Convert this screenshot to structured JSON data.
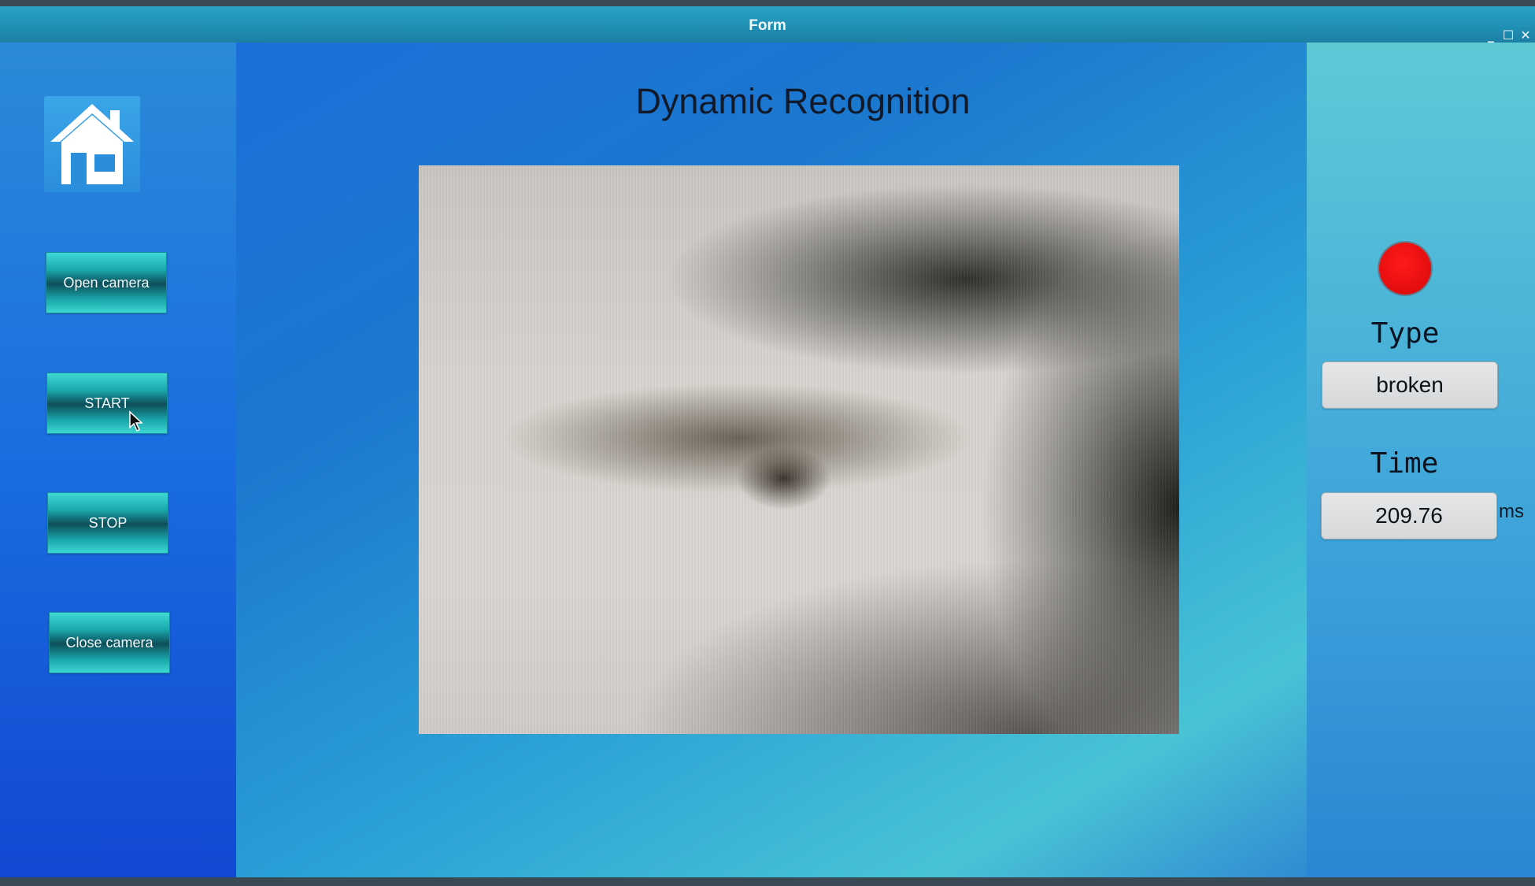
{
  "window": {
    "title": "Form",
    "controls": {
      "minimize": "_",
      "maximize": "☐",
      "close": "✕"
    }
  },
  "header": {
    "title": "Dynamic Recognition"
  },
  "sidebar": {
    "home_icon": "home-icon",
    "buttons": [
      {
        "label": "Open camera"
      },
      {
        "label": "START"
      },
      {
        "label": "STOP"
      },
      {
        "label": "Close camera"
      }
    ]
  },
  "results": {
    "status_color": "#e60f0f",
    "type_label": "Type",
    "type_value": "broken",
    "time_label": "Time",
    "time_value": "209.76",
    "time_unit": "ms"
  },
  "colors": {
    "titlebar": "#2aa3c6",
    "button_teal": "#19a9ad",
    "status_red": "#e60f0f"
  }
}
